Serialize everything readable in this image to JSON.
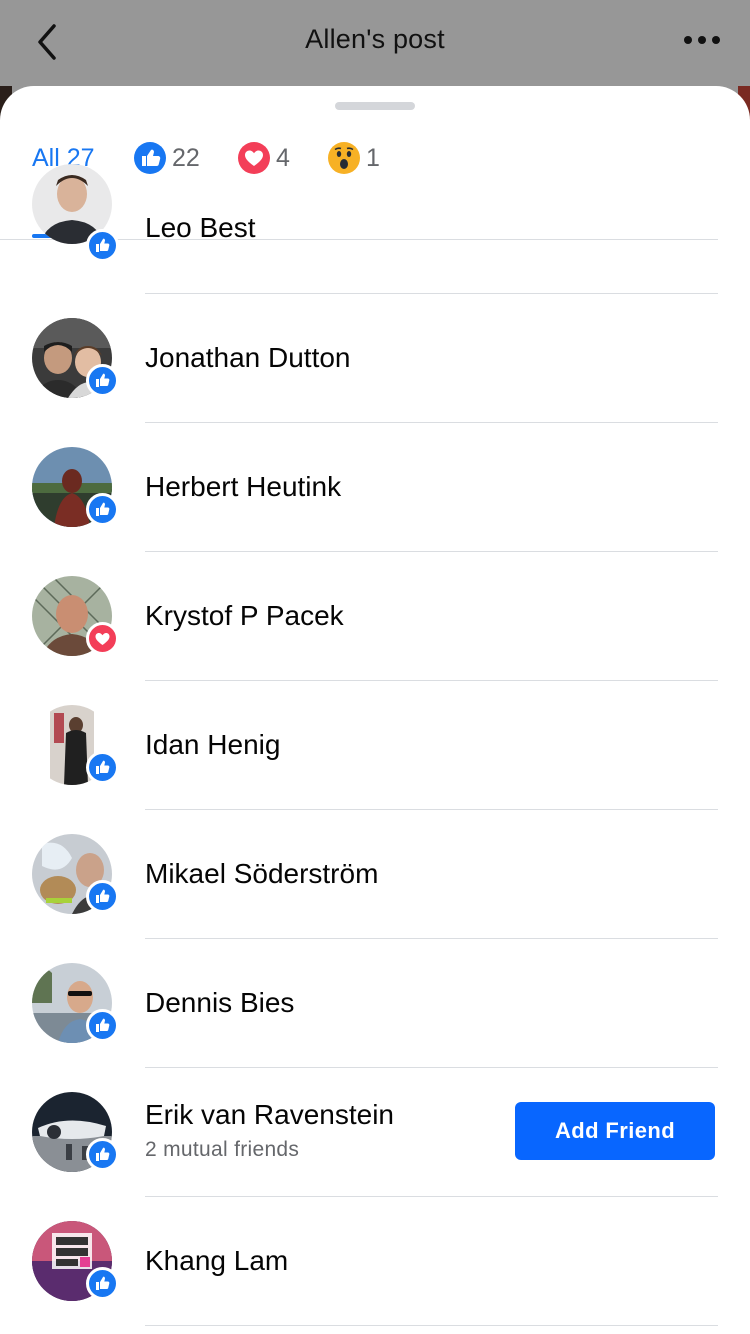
{
  "header": {
    "title": "Allen's post",
    "back_icon": "chevron-left-icon",
    "more_icon": "more-horizontal-icon"
  },
  "tabs": [
    {
      "label": "All 27",
      "icon": null,
      "active": true
    },
    {
      "label": "22",
      "icon": "like-icon",
      "active": false
    },
    {
      "label": "4",
      "icon": "love-icon",
      "active": false
    },
    {
      "label": "1",
      "icon": "wow-icon",
      "active": false
    }
  ],
  "people": [
    {
      "name": "Leo Best",
      "reaction": "like"
    },
    {
      "name": "Jonathan Dutton",
      "reaction": "like"
    },
    {
      "name": "Herbert Heutink",
      "reaction": "like"
    },
    {
      "name": "Krystof P Pacek",
      "reaction": "love"
    },
    {
      "name": "Idan Henig",
      "reaction": "like"
    },
    {
      "name": "Mikael Söderström",
      "reaction": "like"
    },
    {
      "name": "Dennis Bies",
      "reaction": "like"
    },
    {
      "name": "Erik van Ravenstein",
      "reaction": "like",
      "subtitle": "2 mutual friends",
      "action": "Add Friend"
    },
    {
      "name": "Khang Lam",
      "reaction": "like"
    }
  ],
  "colors": {
    "accent": "#1877f2",
    "button": "#0866ff",
    "love": "#f33e58",
    "overlay": "#979797"
  }
}
